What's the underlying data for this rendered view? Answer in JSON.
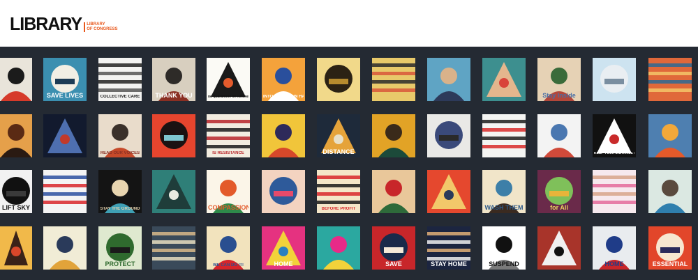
{
  "header": {
    "logo_word": "LIBRARY",
    "logo_sub_line1": "LIBRARY",
    "logo_sub_line2": "OF CONGRESS",
    "accent_color": "#e8571b"
  },
  "wall": {
    "background": "#242a33",
    "posters": [
      {
        "bg": "#e9e4da",
        "fg": "#1b1b1b",
        "accent": "#d63a2a",
        "text": "",
        "text_color": "#111"
      },
      {
        "bg": "#3b8fb0",
        "fg": "#f2efe4",
        "accent": "#1d3c55",
        "text": "SAVE LIVES",
        "text_color": "#ffffff"
      },
      {
        "bg": "#f3f3f1",
        "fg": "#222222",
        "accent": "#555555",
        "text": "COLLECTIVE CARE",
        "text_color": "#111"
      },
      {
        "bg": "#d8cfbf",
        "fg": "#2e2b28",
        "accent": "#8a2f23",
        "text": "THANK YOU",
        "text_color": "#ffffff"
      },
      {
        "bg": "#fbfaf5",
        "fg": "#1a1a1a",
        "accent": "#e45b2c",
        "text": "no quarantine on kindness",
        "text_color": "#111"
      },
      {
        "bg": "#f4a23b",
        "fg": "#2a4f9c",
        "accent": "#ffffff",
        "text": "INTO YOUR OWN HANDS",
        "text_color": "#ffffff"
      },
      {
        "bg": "#f1d98a",
        "fg": "#2b2214",
        "accent": "#b68b2e",
        "text": "",
        "text_color": "#111"
      },
      {
        "bg": "#e8c96a",
        "fg": "#2a2a2a",
        "accent": "#d8573a",
        "text": "",
        "text_color": "#111"
      },
      {
        "bg": "#5fa4c4",
        "fg": "#d9b28a",
        "accent": "#2d3a5a",
        "text": "",
        "text_color": "#111"
      },
      {
        "bg": "#3d8f8f",
        "fg": "#e4b68d",
        "accent": "#d9443a",
        "text": "",
        "text_color": "#111"
      },
      {
        "bg": "#e6d2b5",
        "fg": "#3a6b3a",
        "accent": "#b3473a",
        "text": "Stay Inside",
        "text_color": "#4a6fa5"
      },
      {
        "bg": "#cde3f0",
        "fg": "#e9eef2",
        "accent": "#7a8ea0",
        "text": "",
        "text_color": "#111"
      },
      {
        "bg": "#e0683a",
        "fg": "#2c6a95",
        "accent": "#f3c66a",
        "text": "",
        "text_color": "#111"
      },
      {
        "bg": "#e5a04a",
        "fg": "#5a2a14",
        "accent": "#2a1a12",
        "text": "",
        "text_color": "#111"
      },
      {
        "bg": "#121a2e",
        "fg": "#4e6fb0",
        "accent": "#c23a2a",
        "text": "",
        "text_color": "#ffffff"
      },
      {
        "bg": "#e9dccb",
        "fg": "#3a302a",
        "accent": "#c64a2a",
        "text": "READ OUR VOICES",
        "text_color": "#8a2f23"
      },
      {
        "bg": "#e6452e",
        "fg": "#1b1212",
        "accent": "#7ec6d0",
        "text": "",
        "text_color": "#111"
      },
      {
        "bg": "#f2ece0",
        "fg": "#b8262a",
        "accent": "#1a1a1a",
        "text": "IS RESISTANCE",
        "text_color": "#b8262a"
      },
      {
        "bg": "#f1c53a",
        "fg": "#2e2a5a",
        "accent": "#d6482a",
        "text": "",
        "text_color": "#111"
      },
      {
        "bg": "#1e2a3a",
        "fg": "#e5a33a",
        "accent": "#e8e0c8",
        "text": "DISTANCE",
        "text_color": "#ffffff"
      },
      {
        "bg": "#e2a326",
        "fg": "#3a2a1a",
        "accent": "#1c4a3a",
        "text": "",
        "text_color": "#111"
      },
      {
        "bg": "#e9e9e6",
        "fg": "#3a4a7a",
        "accent": "#2a2a2a",
        "text": "",
        "text_color": "#111"
      },
      {
        "bg": "#f4f4f2",
        "fg": "#1c1c1c",
        "accent": "#d82a2a",
        "text": "",
        "text_color": "#111"
      },
      {
        "bg": "#f3f3f3",
        "fg": "#4a77b0",
        "accent": "#d04a3a",
        "text": "",
        "text_color": "#111"
      },
      {
        "bg": "#111111",
        "fg": "#ffffff",
        "accent": "#c92a2a",
        "text": "KEEP YOUR DISTANCE BUT STAY IN TOUCH",
        "text_color": "#ffffff"
      },
      {
        "bg": "#4e7fb0",
        "fg": "#f2a83a",
        "accent": "#e45a2a",
        "text": "",
        "text_color": "#111"
      },
      {
        "bg": "#f2f2f2",
        "fg": "#111111",
        "accent": "#3a3a3a",
        "text": "LIFT SKY",
        "text_color": "#111"
      },
      {
        "bg": "#f4f4f4",
        "fg": "#2a4fa0",
        "accent": "#d8262a",
        "text": "",
        "text_color": "#111"
      },
      {
        "bg": "#141414",
        "fg": "#e8d5b0",
        "accent": "#3fa0b5",
        "text": "STAY THE GROUND",
        "text_color": "#e8d5b0"
      },
      {
        "bg": "#2f7f78",
        "fg": "#1f3d3a",
        "accent": "#e8eae0",
        "text": "",
        "text_color": "#111"
      },
      {
        "bg": "#fbf5e8",
        "fg": "#e35a2a",
        "accent": "#2e8a4a",
        "text": "COMPASSION",
        "text_color": "#e35a2a"
      },
      {
        "bg": "#f3d3c0",
        "fg": "#2e5a9a",
        "accent": "#e64a6a",
        "text": "",
        "text_color": "#111"
      },
      {
        "bg": "#f4e6c8",
        "fg": "#d8262a",
        "accent": "#1a1a1a",
        "text": "BEFORE PROFIT",
        "text_color": "#d8262a"
      },
      {
        "bg": "#e9c79a",
        "fg": "#c8262a",
        "accent": "#2e6a3a",
        "text": "",
        "text_color": "#111"
      },
      {
        "bg": "#e5482e",
        "fg": "#f2c86a",
        "accent": "#2a3a5a",
        "text": "",
        "text_color": "#111"
      },
      {
        "bg": "#f1e5c9",
        "fg": "#3d7fa8",
        "accent": "#3a2a20",
        "text": "WASH THEM",
        "text_color": "#2e5a8a"
      },
      {
        "bg": "#6a2a4a",
        "fg": "#7fc05a",
        "accent": "#e8b43a",
        "text": "for All",
        "text_color": "#e8d060"
      },
      {
        "bg": "#f6e9ee",
        "fg": "#d7a48a",
        "accent": "#e46a9a",
        "text": "",
        "text_color": "#111"
      },
      {
        "bg": "#dbe8e2",
        "fg": "#5a4a3e",
        "accent": "#2f7fae",
        "text": "",
        "text_color": "#111"
      },
      {
        "bg": "#f1b94a",
        "fg": "#3a2218",
        "accent": "#d8472a",
        "text": "",
        "text_color": "#111"
      },
      {
        "bg": "#f1ecd6",
        "fg": "#2a3a5a",
        "accent": "#e1a33a",
        "text": "",
        "text_color": "#111"
      },
      {
        "bg": "#dfe9cf",
        "fg": "#2f6a2e",
        "accent": "#1a1a1a",
        "text": "PROTECT",
        "text_color": "#2f6a2e"
      },
      {
        "bg": "#3a4a5a",
        "fg": "#d9b88a",
        "accent": "#e8ddc0",
        "text": "",
        "text_color": "#111"
      },
      {
        "bg": "#f2e3bd",
        "fg": "#2a4f90",
        "accent": "#d6242a",
        "text": "WE CAN DO IT!",
        "text_color": "#2a4f90"
      },
      {
        "bg": "#e53280",
        "fg": "#f2d23a",
        "accent": "#2a7fc0",
        "text": "HOME",
        "text_color": "#ffffff"
      },
      {
        "bg": "#2ba8a0",
        "fg": "#e82a88",
        "accent": "#f2d23a",
        "text": "",
        "text_color": "#111"
      },
      {
        "bg": "#c8262a",
        "fg": "#1a2a4a",
        "accent": "#f4e9d8",
        "text": "SAVE",
        "text_color": "#ffffff"
      },
      {
        "bg": "#1c2540",
        "fg": "#e2b078",
        "accent": "#f0f0f0",
        "text": "STAY HOME",
        "text_color": "#ffffff"
      },
      {
        "bg": "#ffffff",
        "fg": "#111111",
        "accent": "#7a7a7a",
        "text": "SUSPEND",
        "text_color": "#111"
      },
      {
        "bg": "#a8342a",
        "fg": "#f0f0f0",
        "accent": "#111111",
        "text": "",
        "text_color": "#111"
      },
      {
        "bg": "#e9ecef",
        "fg": "#1f3c88",
        "accent": "#c8262a",
        "text": "HOME",
        "text_color": "#1f3c88"
      },
      {
        "bg": "#e2462a",
        "fg": "#f7e6d0",
        "accent": "#2a2a5a",
        "text": "ESSENTIAL",
        "text_color": "#ffffff"
      }
    ]
  }
}
